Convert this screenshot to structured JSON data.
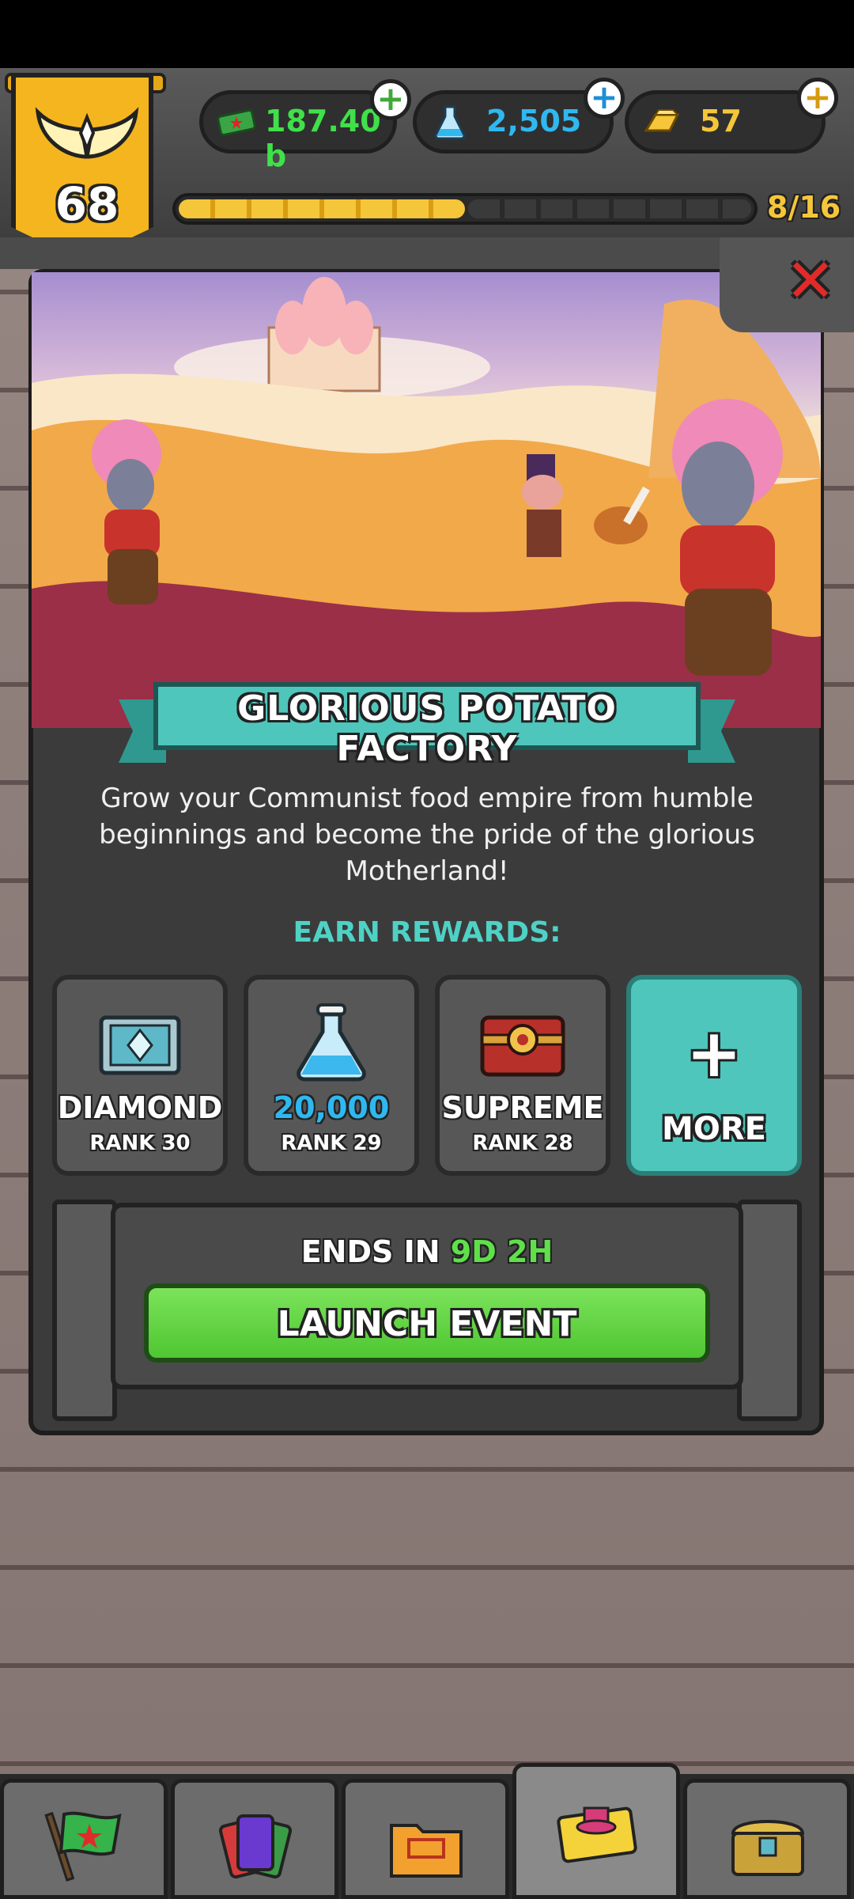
{
  "hud": {
    "rank": "68",
    "currencies": [
      {
        "name": "cash",
        "value": "187.40 b",
        "color": "#3fe04a",
        "plus_color": "#3fa83a"
      },
      {
        "name": "science",
        "value": "2,505",
        "color": "#2fb8f0",
        "plus_color": "#1d8fd6"
      },
      {
        "name": "gold",
        "value": "57",
        "color": "#f5c63a",
        "plus_color": "#d79a10"
      }
    ],
    "xp": {
      "text": "8/16",
      "current": 8,
      "total": 16
    }
  },
  "event": {
    "title": "GLORIOUS POTATO FACTORY",
    "description": "Grow your Communist food empire from humble beginnings and become the pride of the glorious Motherland!",
    "earn_label": "EARN REWARDS:",
    "rewards": [
      {
        "name": "DIAMOND",
        "rank": "RANK 30",
        "icon": "diamond-crate-icon",
        "name_color": "#ffffff"
      },
      {
        "name": "20,000",
        "rank": "RANK 29",
        "icon": "science-flask-icon",
        "name_color": "#2fb8f0"
      },
      {
        "name": "SUPREME",
        "rank": "RANK 28",
        "icon": "supreme-crate-icon",
        "name_color": "#ffffff"
      }
    ],
    "more_label": "MORE",
    "ends_label": "ENDS IN",
    "ends_days": "9D",
    "ends_hours": "2H",
    "launch_label": "LAUNCH EVENT"
  },
  "nav": [
    {
      "name": "flag-icon",
      "active": false
    },
    {
      "name": "cards-icon",
      "active": false
    },
    {
      "name": "folder-icon",
      "active": false
    },
    {
      "name": "event-ticket-icon",
      "active": true
    },
    {
      "name": "treasure-chest-icon",
      "active": false
    }
  ]
}
